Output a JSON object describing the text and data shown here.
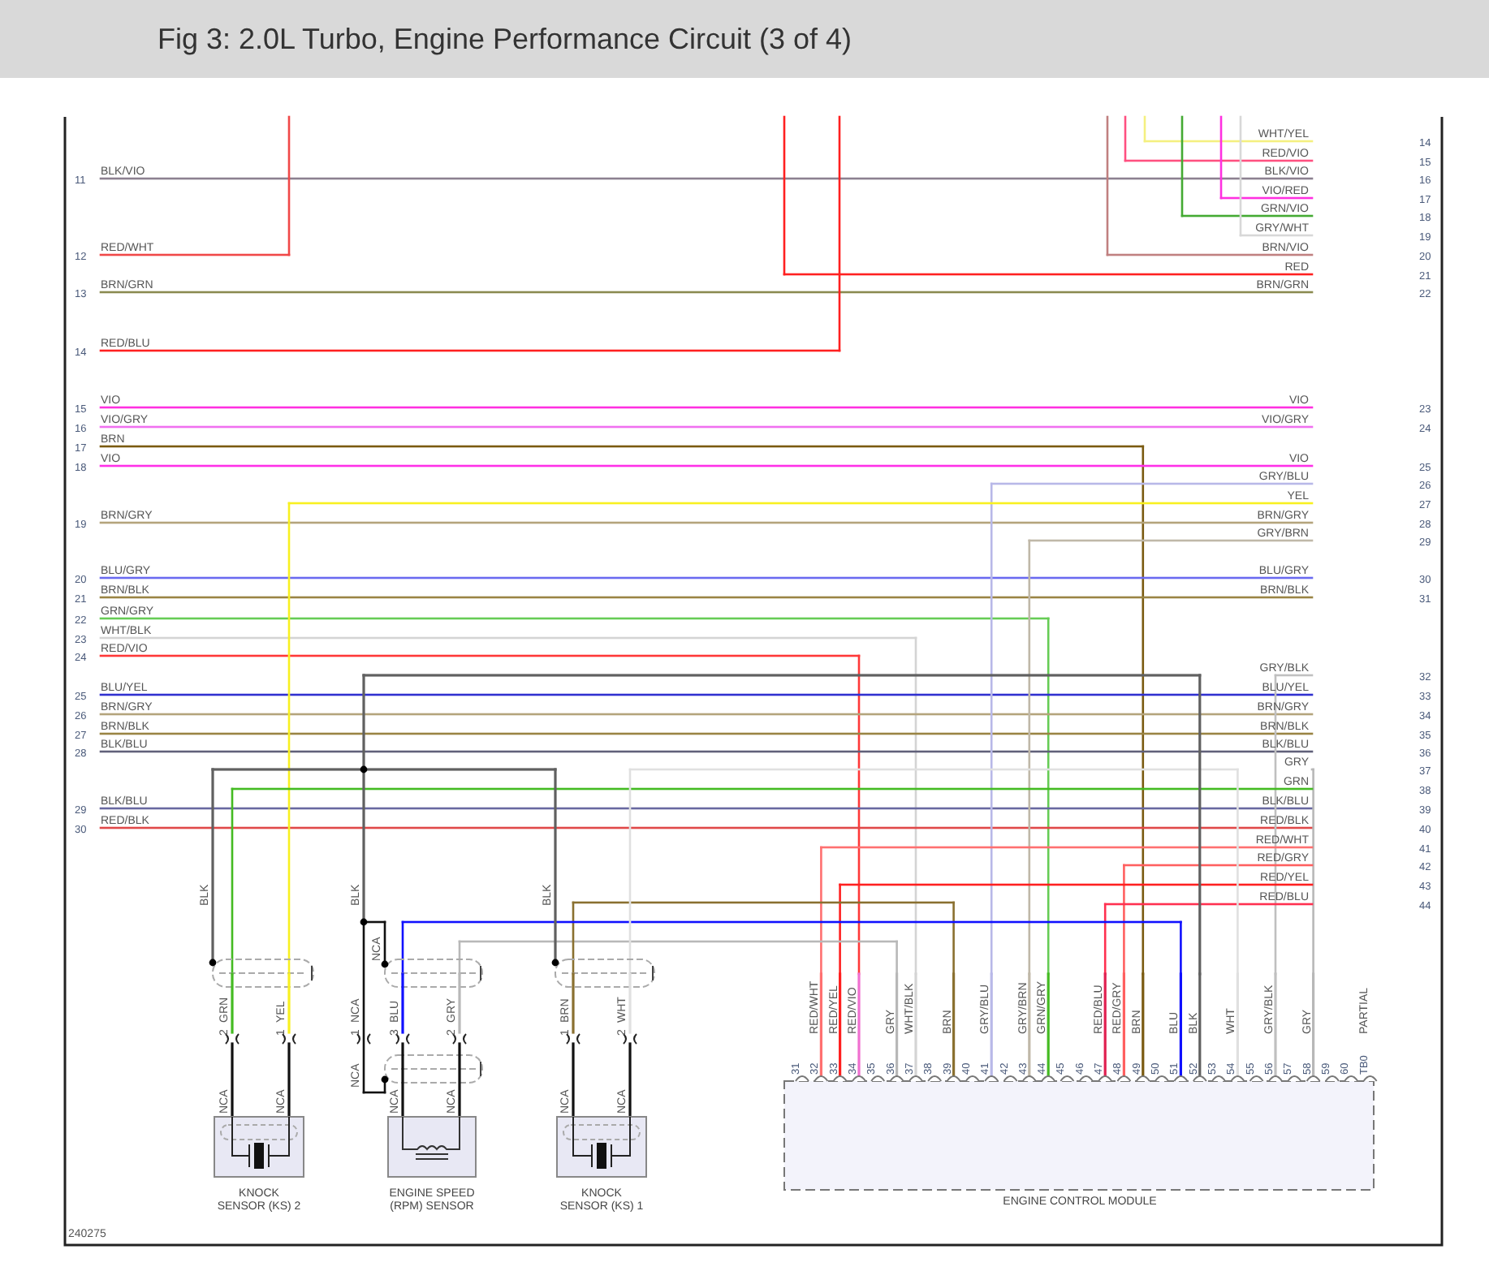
{
  "title": "Fig 3: 2.0L Turbo, Engine Performance Circuit (3 of 4)",
  "left_wires": [
    {
      "number": "11",
      "label": "BLK/VIO",
      "color": "#8c8090"
    },
    {
      "number": "12",
      "label": "RED/WHT",
      "color": "#f04848"
    },
    {
      "number": "13",
      "label": "BRN/GRN",
      "color": "#8a8a50"
    },
    {
      "number": "14",
      "label": "RED/BLU",
      "color": "#ff2020"
    },
    {
      "number": "15",
      "label": "VIO",
      "color": "#ff30e0"
    },
    {
      "number": "16",
      "label": "VIO/GRY",
      "color": "#f070f0"
    },
    {
      "number": "17",
      "label": "BRN",
      "color": "#7a5a10"
    },
    {
      "number": "18",
      "label": "VIO",
      "color": "#ff30e8"
    },
    {
      "number": "19",
      "label": "BRN/GRY",
      "color": "#b4a47c"
    },
    {
      "number": "20",
      "label": "BLU/GRY",
      "color": "#6a6af0"
    },
    {
      "number": "21",
      "label": "BRN/BLK",
      "color": "#9a8444"
    },
    {
      "number": "22",
      "label": "GRN/GRY",
      "color": "#66cc55"
    },
    {
      "number": "23",
      "label": "WHT/BLK",
      "color": "#d4d4d4"
    },
    {
      "number": "24",
      "label": "RED/VIO",
      "color": "#ff3838"
    },
    {
      "number": "25",
      "label": "BLU/YEL",
      "color": "#3030d0"
    },
    {
      "number": "26",
      "label": "BRN/GRY",
      "color": "#b4a47c"
    },
    {
      "number": "27",
      "label": "BRN/BLK",
      "color": "#9a8444"
    },
    {
      "number": "28",
      "label": "BLK/BLU",
      "color": "#60607a"
    },
    {
      "number": "29",
      "label": "BLK/BLU",
      "color": "#6868a0"
    },
    {
      "number": "30",
      "label": "RED/BLK",
      "color": "#e04848"
    }
  ],
  "right_wires": [
    {
      "number": "14",
      "label": "WHT/YEL",
      "color": "#f4f080"
    },
    {
      "number": "15",
      "label": "RED/VIO",
      "color": "#ff5080"
    },
    {
      "number": "16",
      "label": "BLK/VIO"
    },
    {
      "number": "17",
      "label": "VIO/RED",
      "color": "#ff30e0"
    },
    {
      "number": "18",
      "label": "GRN/VIO",
      "color": "#44aa33"
    },
    {
      "number": "19",
      "label": "GRY/WHT",
      "color": "#d8d8d8"
    },
    {
      "number": "20",
      "label": "BRN/VIO",
      "color": "#c08080"
    },
    {
      "number": "21",
      "label": "RED",
      "color": "#ff2020"
    },
    {
      "number": "22",
      "label": "BRN/GRN"
    },
    {
      "number": "23",
      "label": "VIO"
    },
    {
      "number": "24",
      "label": "VIO/GRY"
    },
    {
      "number": "25",
      "label": "VIO"
    },
    {
      "number": "26",
      "label": "GRY/BLU",
      "color": "#b8b8e8"
    },
    {
      "number": "27",
      "label": "YEL",
      "color": "#f8f020"
    },
    {
      "number": "28",
      "label": "BRN/GRY"
    },
    {
      "number": "29",
      "label": "GRY/BRN",
      "color": "#c0b8a8"
    },
    {
      "number": "30",
      "label": "BLU/GRY"
    },
    {
      "number": "31",
      "label": "BRN/BLK"
    },
    {
      "number": "32",
      "label": "GRY/BLK",
      "color": "#c0c0c0"
    },
    {
      "number": "33",
      "label": "BLU/YEL"
    },
    {
      "number": "34",
      "label": "BRN/GRY"
    },
    {
      "number": "35",
      "label": "BRN/BLK"
    },
    {
      "number": "36",
      "label": "BLK/BLU"
    },
    {
      "number": "37",
      "label": "GRY",
      "color": "#b8b8b8"
    },
    {
      "number": "38",
      "label": "GRN",
      "color": "#44bb22"
    },
    {
      "number": "39",
      "label": "BLK/BLU"
    },
    {
      "number": "40",
      "label": "RED/BLK"
    },
    {
      "number": "41",
      "label": "RED/WHT",
      "color": "#ff7070"
    },
    {
      "number": "42",
      "label": "RED/GRY",
      "color": "#ff6060"
    },
    {
      "number": "43",
      "label": "RED/YEL",
      "color": "#ff2020"
    },
    {
      "number": "44",
      "label": "RED/BLU",
      "color": "#ff3050"
    }
  ],
  "sensors": [
    {
      "kind": "knock",
      "name_lines": [
        "KNOCK",
        "SENSOR (KS) 2"
      ],
      "shield_wire": "BLK",
      "pins": [
        {
          "number": "2",
          "wire": "GRN",
          "color": "#44bb22",
          "body_wire": "NCA"
        },
        {
          "number": "1",
          "wire": "YEL",
          "color": "#f8f020",
          "body_wire": "NCA"
        }
      ]
    },
    {
      "kind": "rpm",
      "name_lines": [
        "ENGINE SPEED",
        "(RPM) SENSOR"
      ],
      "shield_wire": "BLK",
      "drain_labels": [
        "NCA",
        "NCA"
      ],
      "pins": [
        {
          "number": "1",
          "wire": "NCA",
          "color": "#111111"
        },
        {
          "number": "3",
          "wire": "BLU",
          "color": "#1010ff",
          "body_wire": "NCA"
        },
        {
          "number": "2",
          "wire": "GRY",
          "color": "#b8b8b8",
          "body_wire": "NCA"
        }
      ]
    },
    {
      "kind": "knock",
      "name_lines": [
        "KNOCK",
        "SENSOR (KS) 1"
      ],
      "shield_wire": "BLK",
      "pins": [
        {
          "number": "1",
          "wire": "BRN",
          "color": "#8a7030",
          "body_wire": "NCA"
        },
        {
          "number": "2",
          "wire": "WHT",
          "color": "#e0e0e0",
          "body_wire": "NCA"
        }
      ]
    }
  ],
  "ecm": {
    "name": "ENGINE CONTROL MODULE",
    "pins": [
      {
        "number": "31"
      },
      {
        "number": "32",
        "wire": "RED/WHT",
        "color": "#ff7070"
      },
      {
        "number": "33",
        "wire": "RED/YEL",
        "color": "#ff2020"
      },
      {
        "number": "34",
        "wire": "RED/VIO",
        "color": "#f070d0"
      },
      {
        "number": "35"
      },
      {
        "number": "36",
        "wire": "GRY",
        "color": "#b8b8b8"
      },
      {
        "number": "37",
        "wire": "WHT/BLK",
        "color": "#d4d4d4"
      },
      {
        "number": "38"
      },
      {
        "number": "39",
        "wire": "BRN",
        "color": "#8a7030"
      },
      {
        "number": "40"
      },
      {
        "number": "41",
        "wire": "GRY/BLU",
        "color": "#b8b8e8"
      },
      {
        "number": "42"
      },
      {
        "number": "43",
        "wire": "GRY/BRN",
        "color": "#c0b8a8"
      },
      {
        "number": "44",
        "wire": "GRN/GRY",
        "color": "#44bb22"
      },
      {
        "number": "45"
      },
      {
        "number": "46"
      },
      {
        "number": "47",
        "wire": "RED/BLU",
        "color": "#e02050"
      },
      {
        "number": "48",
        "wire": "RED/GRY",
        "color": "#ff6060"
      },
      {
        "number": "49",
        "wire": "BRN",
        "color": "#7a5a10"
      },
      {
        "number": "50"
      },
      {
        "number": "51",
        "wire": "BLU",
        "color": "#1010ff"
      },
      {
        "number": "52",
        "wire": "BLK",
        "color": "#606060"
      },
      {
        "number": "53"
      },
      {
        "number": "54",
        "wire": "WHT",
        "color": "#e0e0e0"
      },
      {
        "number": "55"
      },
      {
        "number": "56",
        "wire": "GRY/BLK",
        "color": "#c0c0c0"
      },
      {
        "number": "57"
      },
      {
        "number": "58",
        "wire": "GRY",
        "color": "#b8b8b8"
      },
      {
        "number": "59"
      },
      {
        "number": "60"
      },
      {
        "number": "TB0",
        "wire": "PARTIAL"
      }
    ]
  },
  "figure_code": "240275"
}
